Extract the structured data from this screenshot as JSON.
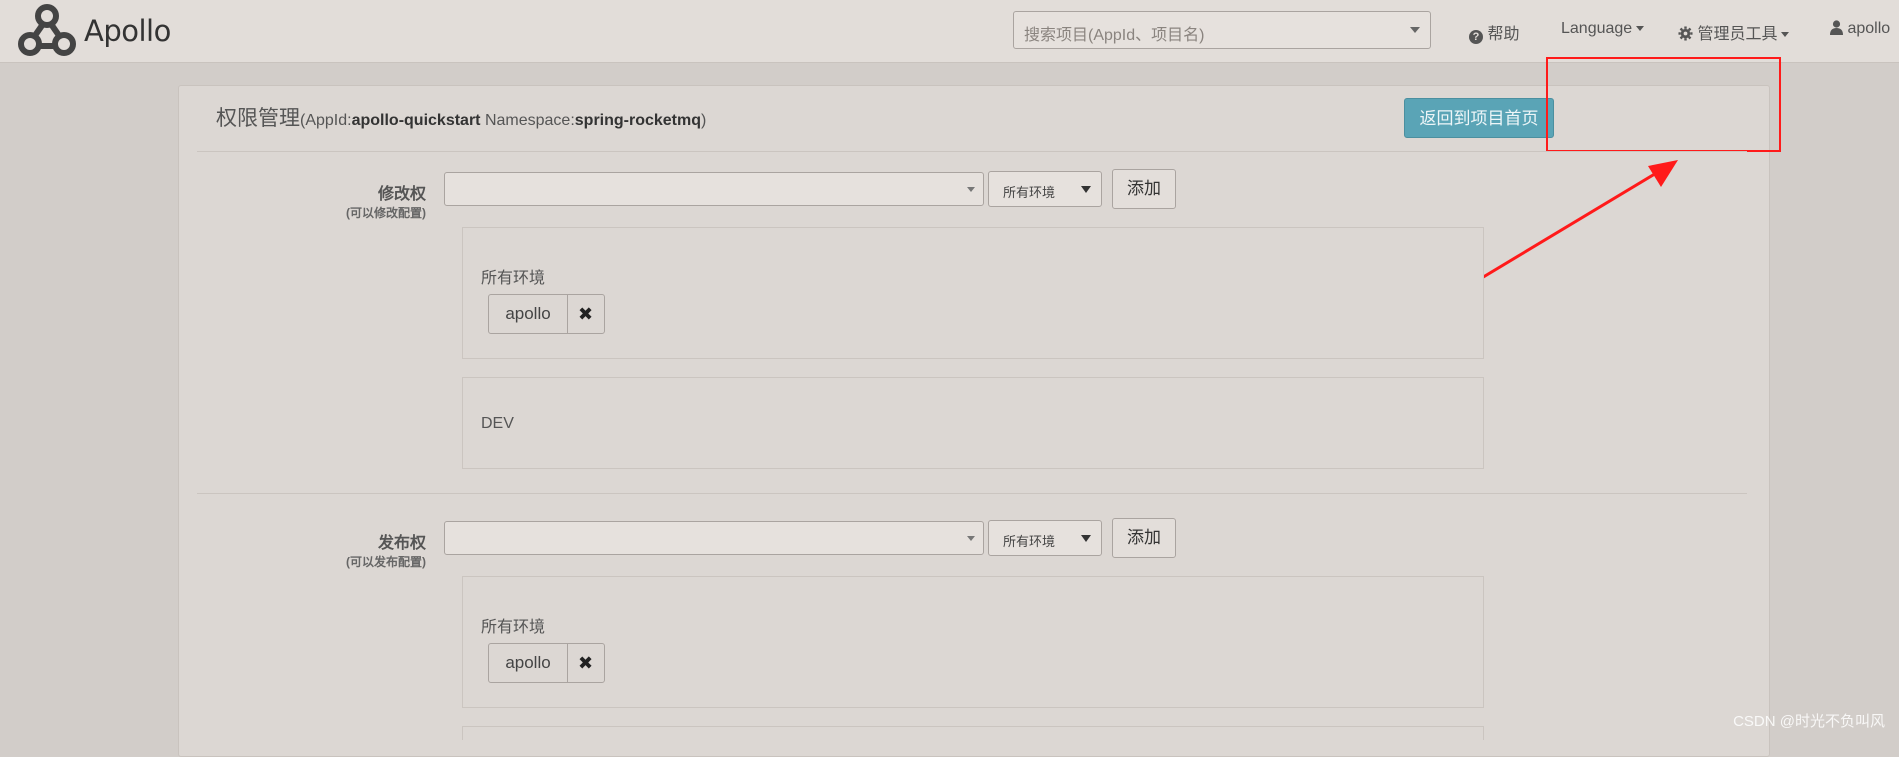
{
  "navbar": {
    "brand": "Apollo",
    "search_placeholder": "搜索项目(AppId、项目名)",
    "help": "帮助",
    "language": "Language",
    "admin_tools": "管理员工具",
    "user": "apollo"
  },
  "panel": {
    "title_main": "权限管理",
    "appid_label": "(AppId:",
    "appid_value": "apollo-quickstart",
    "ns_label": " Namespace:",
    "ns_value": "spring-rocketmq",
    "close_paren": ")",
    "back_button": "返回到项目首页"
  },
  "modify": {
    "label": "修改权",
    "sub": "(可以修改配置)",
    "env_select": "所有环境",
    "add_button": "添加",
    "groups": [
      {
        "env": "所有环境",
        "users": [
          "apollo"
        ]
      },
      {
        "env": "DEV",
        "users": []
      }
    ]
  },
  "release": {
    "label": "发布权",
    "sub": "(可以发布配置)",
    "env_select": "所有环境",
    "add_button": "添加",
    "groups": [
      {
        "env": "所有环境",
        "users": [
          "apollo"
        ]
      }
    ]
  },
  "watermark": "CSDN @时光不负叫风",
  "colors": {
    "accent": "#5aa4b6",
    "highlight": "#ff1a1a"
  }
}
